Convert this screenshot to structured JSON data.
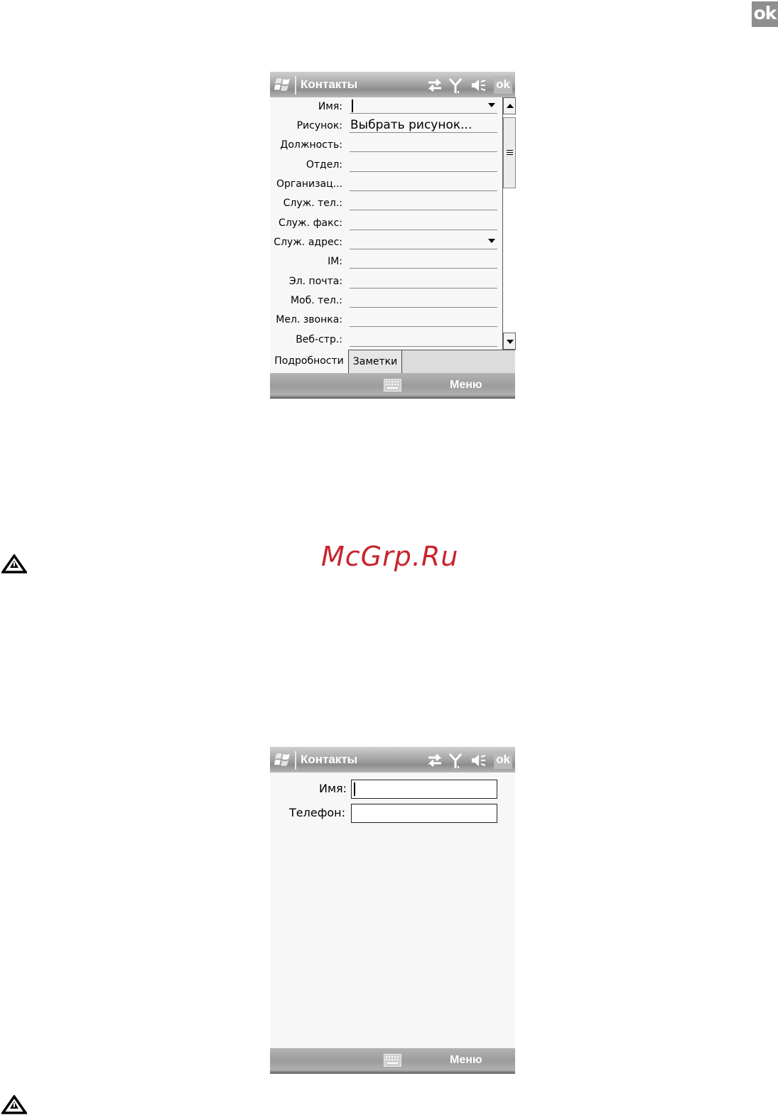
{
  "corner_ok": "ok",
  "watermark": "McGrp.Ru",
  "screen1": {
    "title": "Контакты",
    "ok_label": "ok",
    "fields": [
      {
        "label": "Имя:",
        "value": "",
        "dropdown": true
      },
      {
        "label": "Рисунок:",
        "value": "Выбрать рисунок..."
      },
      {
        "label": "Должность:",
        "value": ""
      },
      {
        "label": "Отдел:",
        "value": ""
      },
      {
        "label": "Организац...",
        "value": ""
      },
      {
        "label": "Служ. тел.:",
        "value": ""
      },
      {
        "label": "Служ. факс:",
        "value": ""
      },
      {
        "label": "Служ. адрес:",
        "value": "",
        "dropdown": true
      },
      {
        "label": "IM:",
        "value": ""
      },
      {
        "label": "Эл. почта:",
        "value": ""
      },
      {
        "label": "Моб. тел.:",
        "value": ""
      },
      {
        "label": "Мел. звонка:",
        "value": ""
      },
      {
        "label": "Веб-стр.:",
        "value": ""
      }
    ],
    "tabs": [
      "Подробности",
      "Заметки"
    ],
    "active_tab": "Подробности",
    "menu_label": "Меню",
    "icons": [
      "windows-start-icon",
      "sync-arrows-icon",
      "signal-antenna-icon",
      "speaker-muted-icon",
      "keyboard-icon"
    ]
  },
  "screen2": {
    "title": "Контакты",
    "ok_label": "ok",
    "fields": [
      {
        "label": "Имя:",
        "value": ""
      },
      {
        "label": "Телефон:",
        "value": ""
      }
    ],
    "menu_label": "Меню"
  },
  "colors": {
    "watermark": "#c8242c",
    "titlebar": "#a7a7a7",
    "background": "#f7f7f7"
  }
}
